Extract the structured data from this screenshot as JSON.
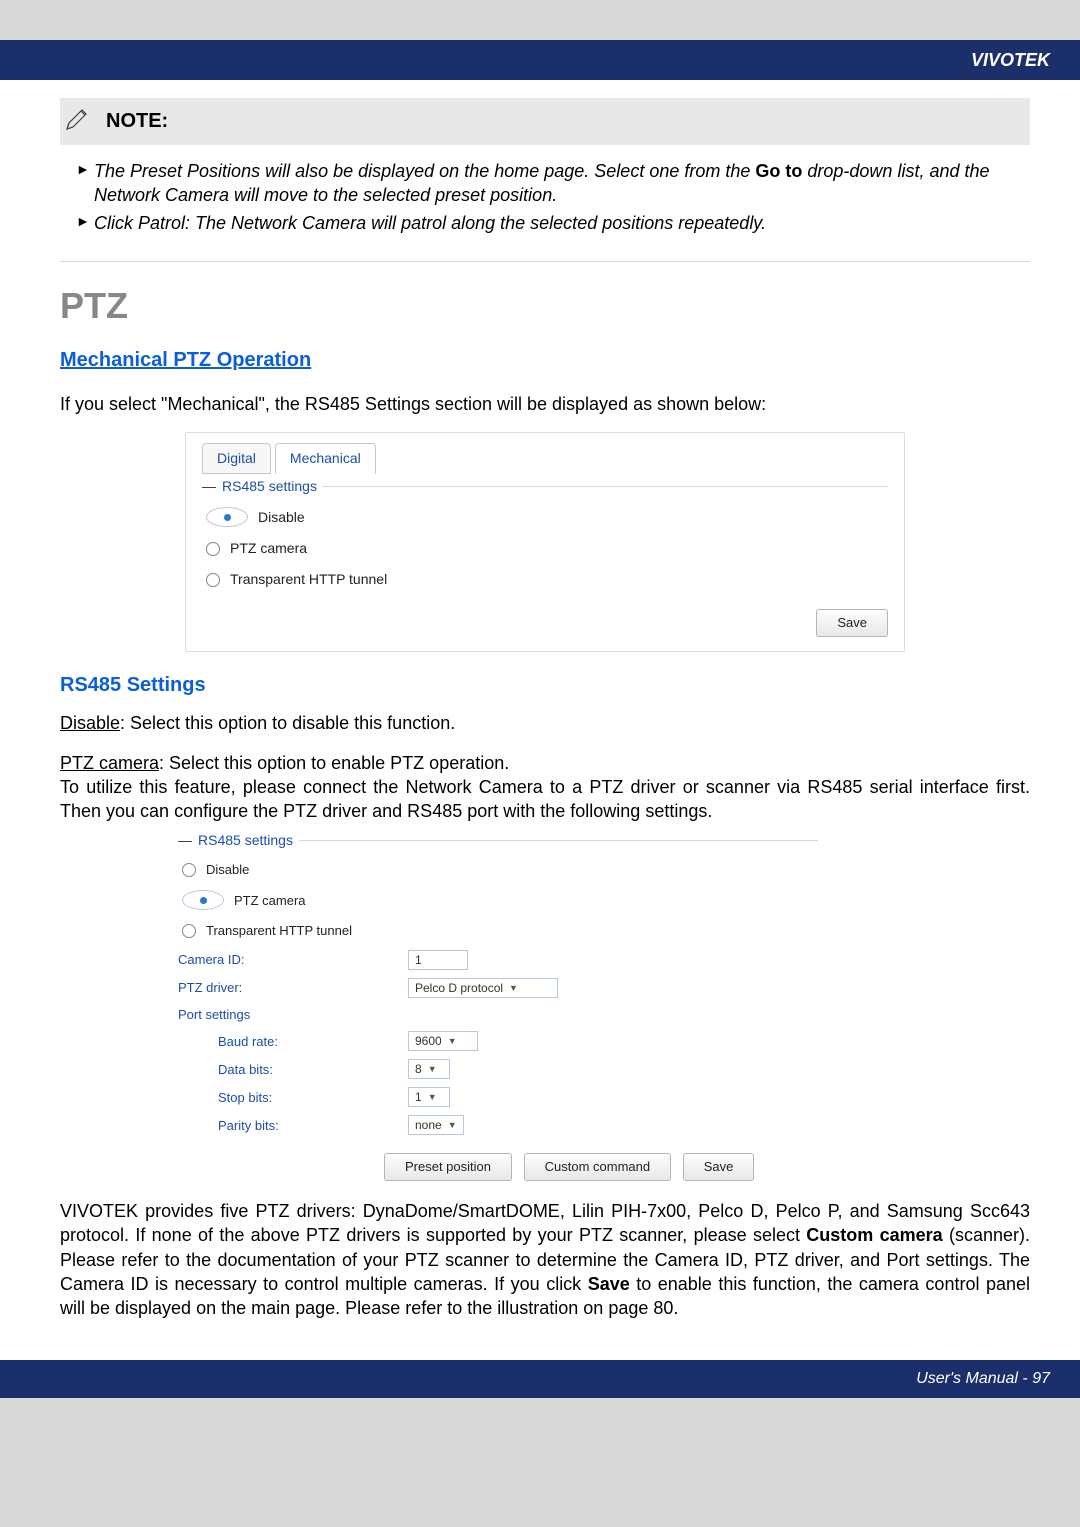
{
  "brand": "VIVOTEK",
  "note": {
    "title": "NOTE:",
    "items": [
      {
        "prefix": "The Preset Positions will also be displayed on the home page. Select one from the ",
        "bold": "Go to",
        "suffix": " drop-down list, and the Network Camera will move to the selected preset position."
      },
      {
        "text": "Click Patrol: The Network Camera will patrol along the selected positions repeatedly."
      }
    ]
  },
  "h1": "PTZ",
  "h2": "Mechanical PTZ Operation",
  "intro": "If you select \"Mechanical\", the RS485 Settings section will be displayed as shown below:",
  "shot1": {
    "tabs": {
      "digital": "Digital",
      "mechanical": "Mechanical"
    },
    "legend": "RS485 settings",
    "options": {
      "disable": "Disable",
      "ptz": "PTZ camera",
      "tunnel": "Transparent HTTP tunnel"
    },
    "save": "Save"
  },
  "h3_settings": "RS485 Settings",
  "disable_label": "Disable",
  "disable_text": ": Select this option to disable this function.",
  "ptz_label": "PTZ camera",
  "ptz_text": ": Select this option to enable PTZ operation.",
  "ptz_para2": "To utilize this feature, please connect the Network Camera to a PTZ driver or scanner via RS485 serial interface first. Then you can configure the PTZ driver and RS485 port with the following settings.",
  "shot2": {
    "legend": "RS485 settings",
    "options": {
      "disable": "Disable",
      "ptz": "PTZ camera",
      "tunnel": "Transparent HTTP tunnel"
    },
    "fields": {
      "camera_id_label": "Camera ID:",
      "camera_id_value": "1",
      "ptz_driver_label": "PTZ driver:",
      "ptz_driver_value": "Pelco D protocol",
      "port_settings": "Port settings",
      "baud_label": "Baud rate:",
      "baud_value": "9600",
      "data_label": "Data bits:",
      "data_value": "8",
      "stop_label": "Stop bits:",
      "stop_value": "1",
      "parity_label": "Parity bits:",
      "parity_value": "none"
    },
    "buttons": {
      "preset": "Preset position",
      "custom": "Custom command",
      "save": "Save"
    }
  },
  "closing": {
    "p1a": "VIVOTEK provides five PTZ drivers: DynaDome/SmartDOME, Lilin PIH-7x00, Pelco D, Pelco P, and Samsung Scc643 protocol. If none of the above PTZ drivers is supported by your PTZ scanner, please select ",
    "b1": "Custom camera",
    "p1b": " (scanner). Please refer to the documentation of your PTZ scanner to determine the Camera ID, PTZ driver, and Port settings. The Camera ID is necessary to control multiple cameras. If you click ",
    "b2": "Save",
    "p1c": " to enable this function, the camera control panel will be displayed on the main page. Please refer to the illustration on page 80."
  },
  "footer": "User's Manual - 97"
}
